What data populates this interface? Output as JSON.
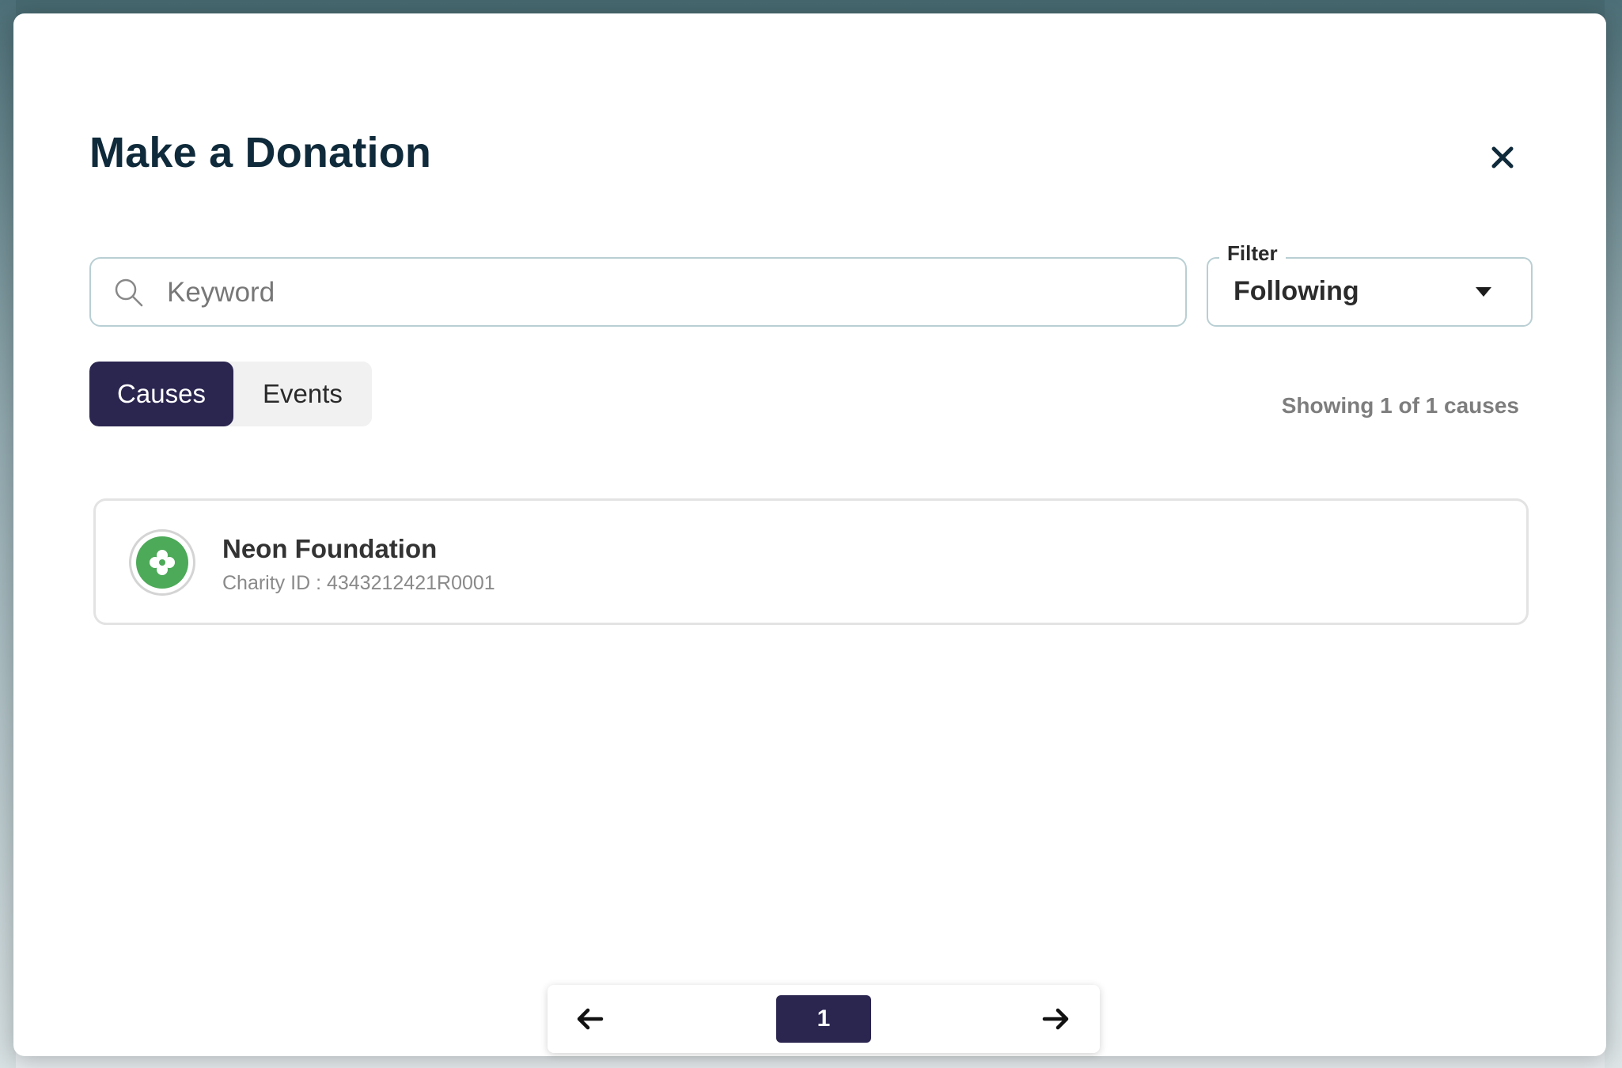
{
  "modal": {
    "title": "Make a Donation"
  },
  "search": {
    "placeholder": "Keyword",
    "value": ""
  },
  "filter": {
    "label": "Filter",
    "selected": "Following"
  },
  "tabs": [
    {
      "label": "Causes",
      "active": true
    },
    {
      "label": "Events",
      "active": false
    }
  ],
  "results": {
    "summary": "Showing 1 of 1 causes"
  },
  "causes": [
    {
      "name": "Neon Foundation",
      "charity_id": "Charity ID : 4343212421R0001",
      "logo_color": "#4caa58"
    }
  ],
  "pagination": {
    "current_page": "1"
  },
  "colors": {
    "accent": "#2b2650",
    "title": "#0f2a3a",
    "border": "#b9cfd3"
  },
  "icons": {
    "close": "close-icon",
    "search": "search-icon",
    "caret": "caret-down-icon",
    "prev": "arrow-left-icon",
    "next": "arrow-right-icon"
  }
}
